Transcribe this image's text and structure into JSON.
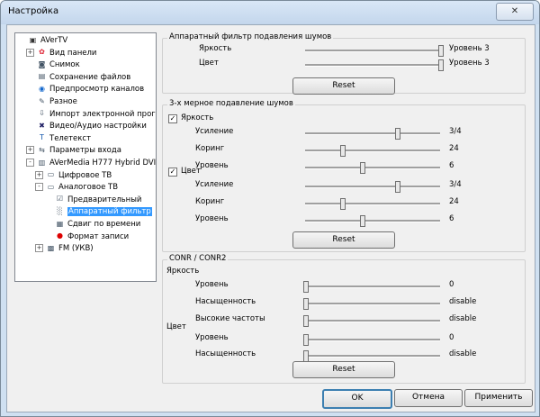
{
  "window": {
    "title": "Настройка",
    "close_icon": "close-icon"
  },
  "tree": [
    {
      "label": "AVerTV",
      "icon": "app-icon",
      "expander": "",
      "selected": false
    },
    {
      "label": "Вид панели",
      "icon": "palette-icon",
      "expander": "+",
      "selected": false
    },
    {
      "label": "Снимок",
      "icon": "camera-icon",
      "expander": "",
      "selected": false
    },
    {
      "label": "Сохранение файлов",
      "icon": "folder-icon",
      "expander": "",
      "selected": false
    },
    {
      "label": "Предпросмотр каналов",
      "icon": "eye-icon",
      "expander": "",
      "selected": false
    },
    {
      "label": "Разное",
      "icon": "misc-icon",
      "expander": "",
      "selected": false
    },
    {
      "label": "Импорт электронной прог",
      "icon": "import-icon",
      "expander": "",
      "selected": false
    },
    {
      "label": "Видео/Аудио настройки",
      "icon": "tools-icon",
      "expander": "",
      "selected": false
    },
    {
      "label": "Телетекст",
      "icon": "teletext-icon",
      "expander": "",
      "selected": false
    },
    {
      "label": "Параметры входа",
      "icon": "input-icon",
      "expander": "+",
      "selected": false
    },
    {
      "label": "AVerMedia H777 Hybrid DVI",
      "icon": "device-icon",
      "expander": "-",
      "selected": false
    },
    {
      "label": "Цифровое ТВ",
      "icon": "tv-icon",
      "expander": "+",
      "selected": false
    },
    {
      "label": "Аналоговое ТВ",
      "icon": "tv-icon",
      "expander": "-",
      "selected": false
    },
    {
      "label": "Предварительный",
      "icon": "checklist-icon",
      "expander": "",
      "selected": false
    },
    {
      "label": "Аппаратный фильтр",
      "icon": "filter-icon",
      "expander": "",
      "selected": true
    },
    {
      "label": "Сдвиг по времени",
      "icon": "film-icon",
      "expander": "",
      "selected": false
    },
    {
      "label": "Формат записи",
      "icon": "record-icon",
      "expander": "",
      "selected": false
    },
    {
      "label": "FM (УКВ)",
      "icon": "radio-icon",
      "expander": "+",
      "selected": false
    }
  ],
  "hw_filter": {
    "title": "Аппаратный фильтр подавления шумов",
    "rows": [
      {
        "label": "Яркость",
        "value": "Уровень 3",
        "level": 1.0
      },
      {
        "label": "Цвет",
        "value": "Уровень 3",
        "level": 1.0
      }
    ],
    "reset": "Reset"
  },
  "nr3d": {
    "title": "3-х мерное подавление шумов",
    "brightness_check": "Яркость",
    "color_check": "Цвет",
    "brightness_rows": [
      {
        "label": "Усиление",
        "value": "3/4",
        "level": 0.68
      },
      {
        "label": "Коринг",
        "value": "24",
        "level": 0.27
      },
      {
        "label": "Уровень",
        "value": "6",
        "level": 0.42
      }
    ],
    "color_rows": [
      {
        "label": "Усиление",
        "value": "3/4",
        "level": 0.68
      },
      {
        "label": "Коринг",
        "value": "24",
        "level": 0.27
      },
      {
        "label": "Уровень",
        "value": "6",
        "level": 0.42
      }
    ],
    "reset": "Reset"
  },
  "conr": {
    "title": "CONR / CONR2",
    "brightness_header": "Яркость",
    "color_header": "Цвет",
    "brightness_rows": [
      {
        "label": "Уровень",
        "value": "0",
        "level": 0
      },
      {
        "label": "Насыщенность",
        "value": "disable",
        "level": 0
      },
      {
        "label": "Высокие частоты",
        "value": "disable",
        "level": 0
      }
    ],
    "color_rows": [
      {
        "label": "Уровень",
        "value": "0",
        "level": 0
      },
      {
        "label": "Насыщенность",
        "value": "disable",
        "level": 0
      }
    ],
    "reset": "Reset"
  },
  "footer": {
    "ok": "OK",
    "cancel": "Отмена",
    "apply": "Применить"
  }
}
